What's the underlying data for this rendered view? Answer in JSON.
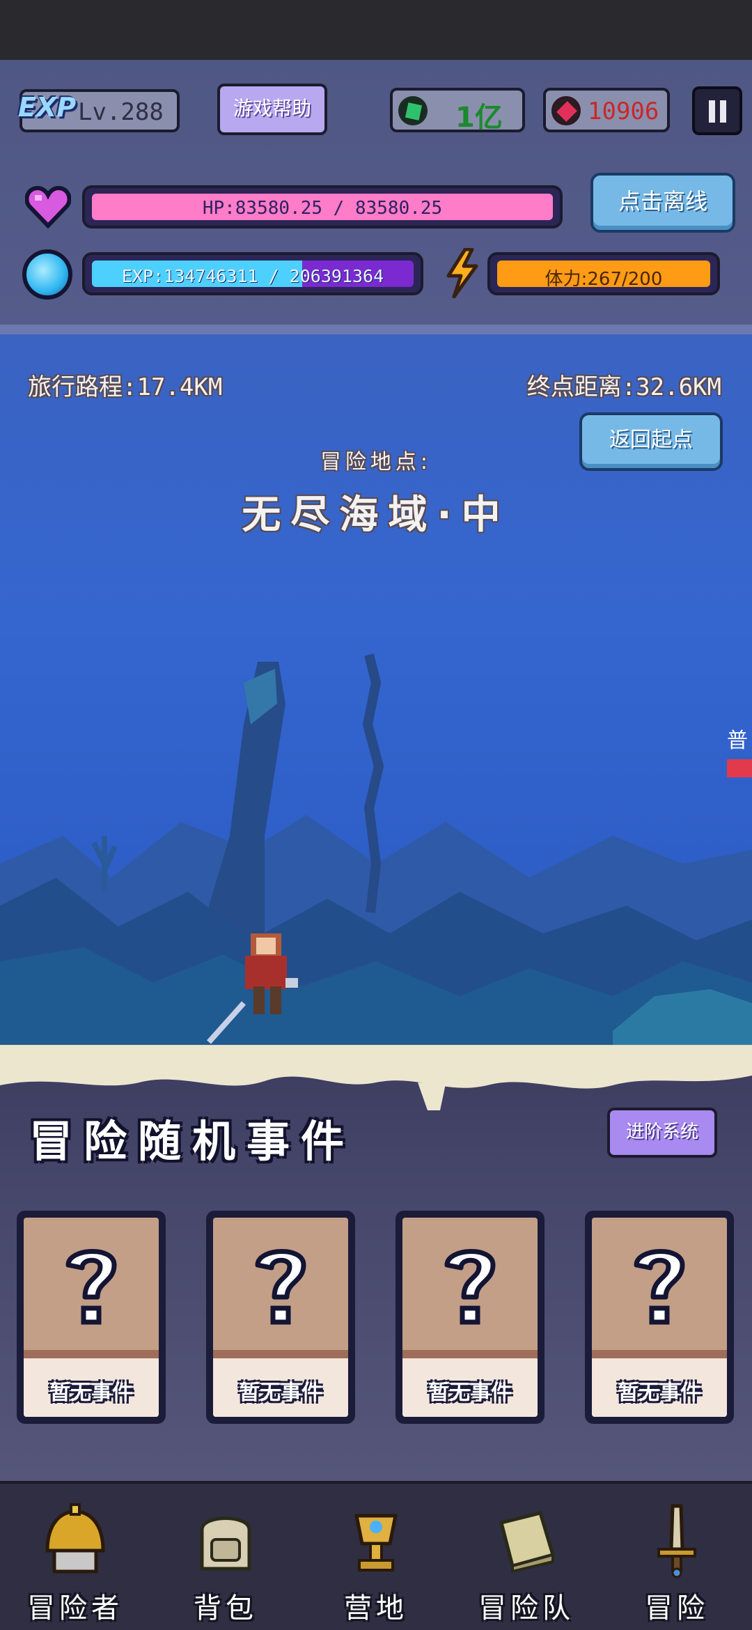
{
  "header": {
    "exp_logo": "EXP",
    "level": "Lv.288",
    "help_label": "游戏帮助",
    "green_gems": "1亿",
    "red_gems": "10906",
    "offline_label": "点击离线",
    "hp_text": "HP:83580.25 / 83580.25",
    "hp_fraction": 1.0,
    "exp_text": "EXP:134746311 / 206391364",
    "exp_fraction": 0.653,
    "stamina_text": "体力:267/200",
    "stamina_fraction": 1.0,
    "icons": [
      "heart-icon",
      "mana-orb-icon",
      "lightning-icon",
      "green-gem-icon",
      "red-gem-icon",
      "pause-icon"
    ]
  },
  "scene": {
    "travel": "旅行路程:17.4KM",
    "remaining": "终点距离:32.6KM",
    "return_label": "返回起点",
    "location_label": "冒险地点:",
    "location_name": "无尽海域·中",
    "enemy_label": "普"
  },
  "events": {
    "title": "冒险随机事件",
    "advance_label": "进阶系统",
    "cards": [
      {
        "label": "暂无事件"
      },
      {
        "label": "暂无事件"
      },
      {
        "label": "暂无事件"
      },
      {
        "label": "暂无事件"
      }
    ]
  },
  "nav": {
    "items": [
      {
        "label": "冒险者",
        "icon": "helmet-icon"
      },
      {
        "label": "背包",
        "icon": "backpack-icon"
      },
      {
        "label": "营地",
        "icon": "trophy-icon"
      },
      {
        "label": "冒险队",
        "icon": "book-icon"
      },
      {
        "label": "冒险",
        "icon": "sword-icon"
      }
    ]
  },
  "colors": {
    "hp": "#ff7cc8",
    "exp": "#4ed0ff",
    "stamina": "#ff9b15",
    "button_blue": "#76b9e6",
    "button_purple": "#b8a8f0"
  }
}
